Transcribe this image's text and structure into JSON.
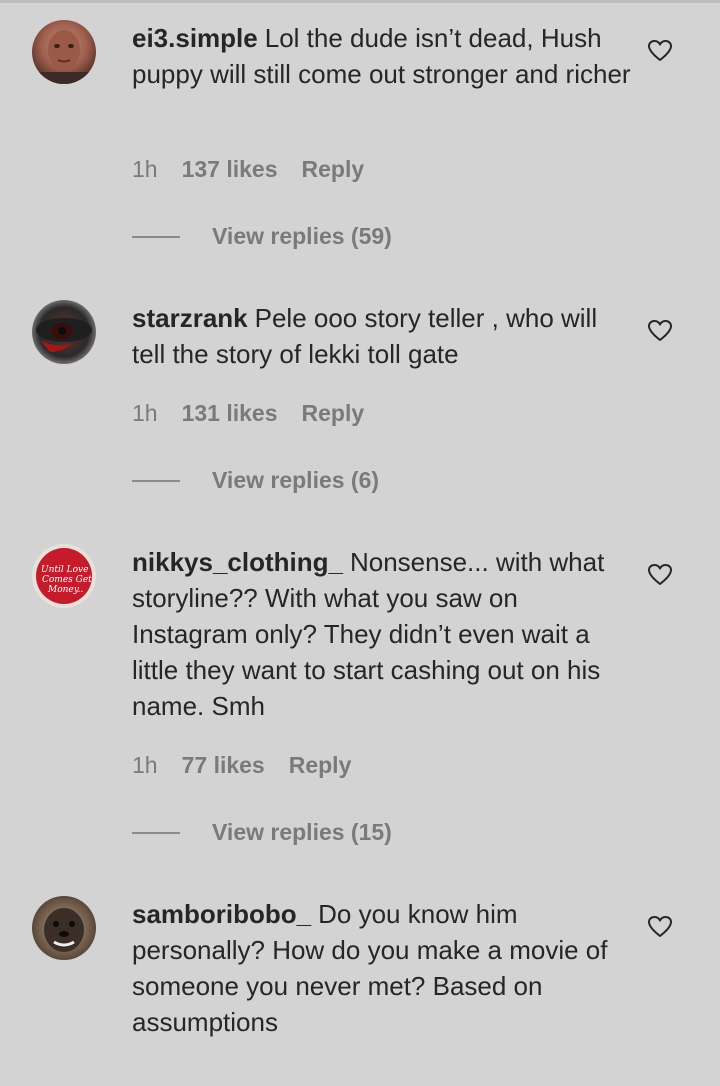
{
  "comments": [
    {
      "username": "ei3.simple",
      "text": "Lol the dude isn’t dead, Hush puppy will still come out stronger and richer",
      "time": "1h",
      "likes": "137 likes",
      "reply": "Reply",
      "view_replies": "View replies (59)",
      "avatar_colors": [
        "#b26b5a",
        "#5a3026"
      ]
    },
    {
      "username": "starzrank",
      "text": "Pele ooo story teller , who will tell the story of lekki toll gate",
      "time": "1h",
      "likes": "131 likes",
      "reply": "Reply",
      "view_replies": "View replies (6)",
      "avatar_colors": [
        "#2b2b2b",
        "#9b1d1d"
      ]
    },
    {
      "username": "nikkys_clothing_",
      "text": "Nonsense... with what storyline?? With what you saw on Instagram only? They didn’t even wait a little they want to start cashing out on his name. Smh",
      "time": "1h",
      "likes": "77 likes",
      "reply": "Reply",
      "view_replies": "View replies (15)",
      "avatar_colors": [
        "#c41c2b",
        "#e8e0dc"
      ],
      "avatar_text": "Until Love Comes Get Money.."
    },
    {
      "username": "samboribobo_",
      "text": "Do you know him personally? How do you make a movie of someone you never met? Based on assumptions",
      "avatar_colors": [
        "#5b4a3c",
        "#b09a82"
      ]
    }
  ]
}
